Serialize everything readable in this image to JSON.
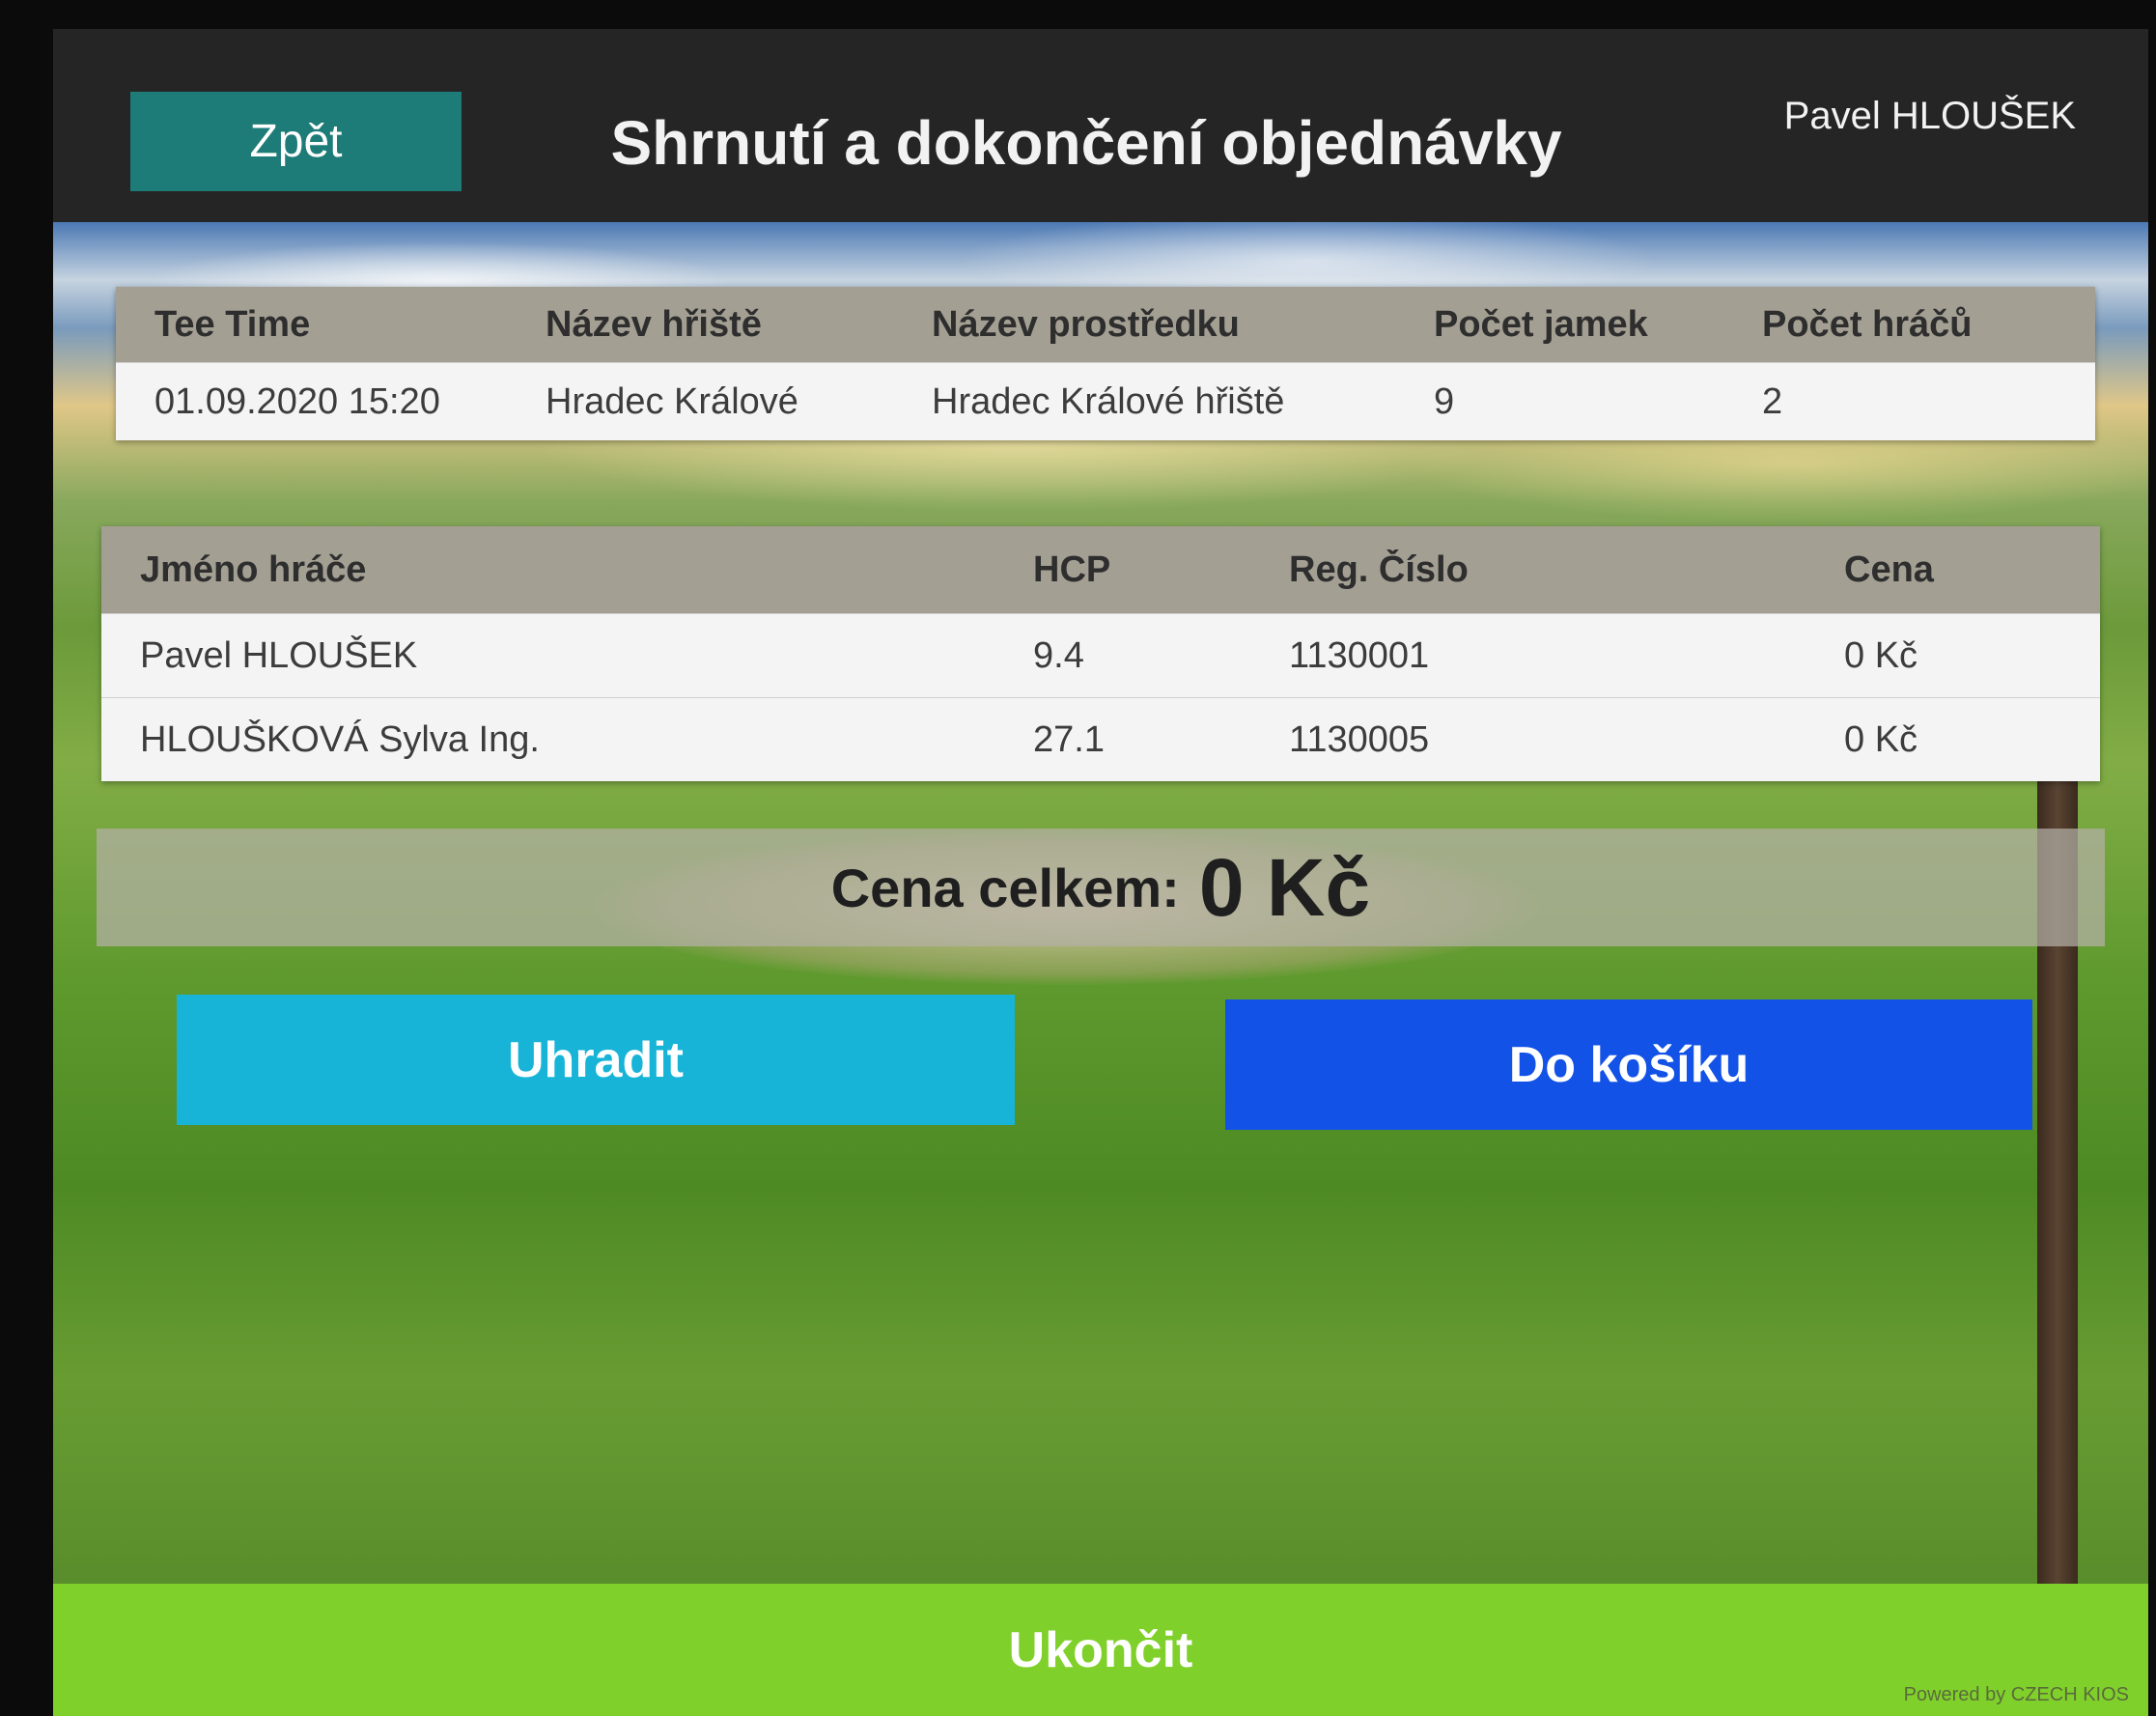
{
  "header": {
    "back_label": "Zpět",
    "title": "Shrnutí a dokončení objednávky",
    "user": "Pavel HLOUŠEK"
  },
  "tee_table": {
    "headers": [
      "Tee Time",
      "Název hřiště",
      "Název prostředku",
      "Počet jamek",
      "Počet hráčů"
    ],
    "row": [
      "01.09.2020 15:20",
      "Hradec Králové",
      "Hradec Králové hřiště",
      "9",
      "2"
    ]
  },
  "players_table": {
    "headers": [
      "Jméno hráče",
      "HCP",
      "Reg. Číslo",
      "Cena"
    ],
    "rows": [
      [
        "Pavel HLOUŠEK",
        "9.4",
        "1130001",
        "0 Kč"
      ],
      [
        "HLOUŠKOVÁ Sylva Ing.",
        "27.1",
        "1130005",
        "0 Kč"
      ]
    ]
  },
  "total": {
    "label": "Cena celkem:",
    "value": "0 Kč"
  },
  "actions": {
    "pay_label": "Uhradit",
    "cart_label": "Do košíku",
    "end_label": "Ukončit"
  },
  "footer": {
    "powered_by": "Powered by CZECH KIOS"
  },
  "colors": {
    "back_button": "#1e7c78",
    "pay_button": "#17b4d8",
    "cart_button": "#1252e6",
    "end_button": "#80d02c",
    "table_header": "#a49f93"
  }
}
